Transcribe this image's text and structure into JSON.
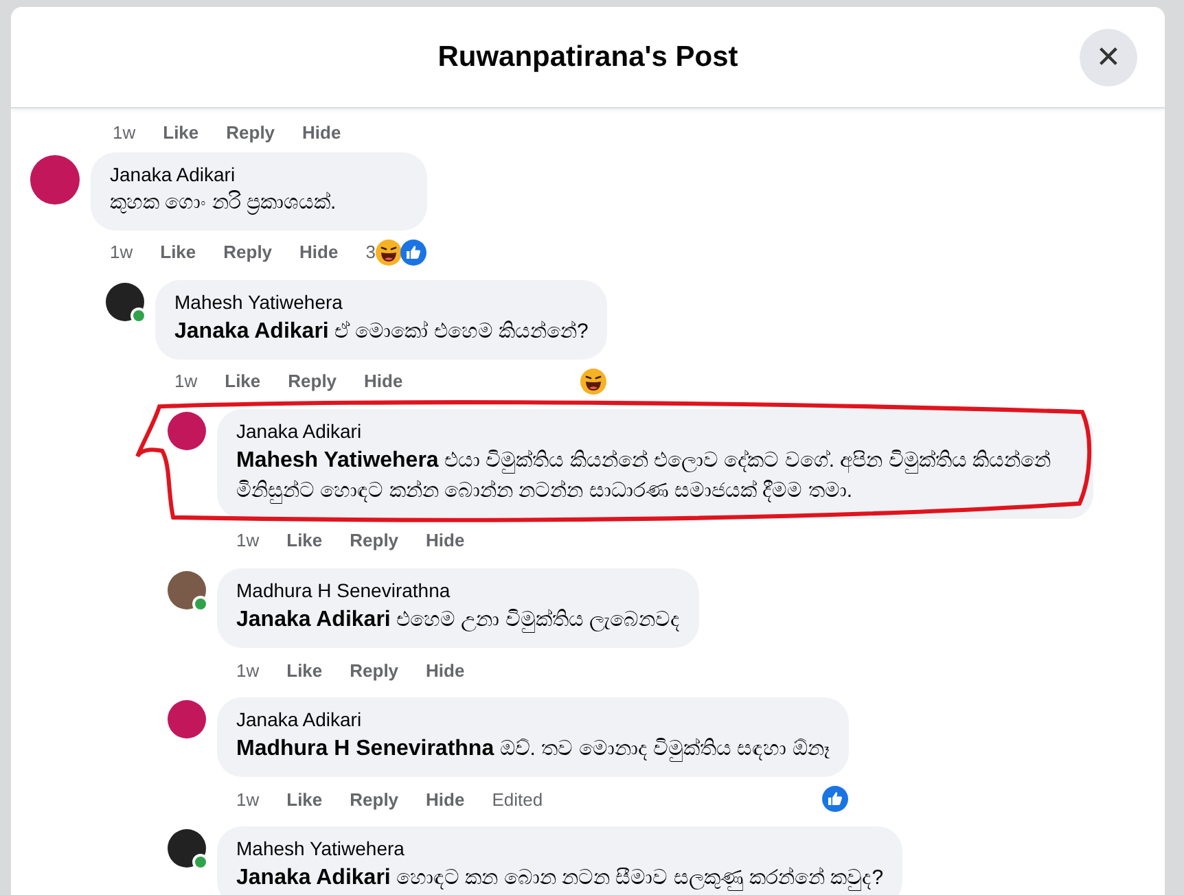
{
  "dialog": {
    "title": "Ruwanpatirana's Post",
    "close_icon": "✕"
  },
  "previous_actions": {
    "time": "1w",
    "actions": [
      "Like",
      "Reply",
      "Hide"
    ]
  },
  "comments": [
    {
      "author": "Janaka Adikari",
      "color": "#c2185b",
      "online": false,
      "highlighted": false,
      "text": "කුහක ගොං නරි ප්‍රකාශයක්.",
      "time": "1w",
      "actions": [
        "Like",
        "Reply",
        "Hide"
      ],
      "reactions": {
        "kind": "inline",
        "count": "3",
        "items": [
          {
            "kind": "haha"
          },
          {
            "kind": "like"
          }
        ]
      },
      "children": [
        {
          "author": "Mahesh Yatiwehera",
          "color": "#222222",
          "online": true,
          "highlighted": false,
          "mention": "Janaka Adikari",
          "text": "ඒ මොකෝ එහෙම කියන්නේ?",
          "time": "1w",
          "actions": [
            "Like",
            "Reply",
            "Hide"
          ],
          "reactions": {
            "kind": "end",
            "items": [
              {
                "kind": "haha"
              }
            ]
          },
          "children": [
            {
              "author": "Janaka Adikari",
              "color": "#c2185b",
              "online": false,
              "highlighted": true,
              "mention": "Mahesh Yatiwehera",
              "text": "එයා විමුක්තිය කියන්නේ එලොව දේකට වගේ. අපින විමුක්තිය කියන්නේ මිනිසුන්ට හොඳට කන්න බොන්න නටන්න සාධාරණ සමාජයක් දීමම තමා.",
              "time": "1w",
              "actions": [
                "Like",
                "Reply",
                "Hide"
              ]
            },
            {
              "author": "Madhura H Senevirathna",
              "color": "#7a5a48",
              "online": true,
              "highlighted": false,
              "mention": "Janaka Adikari",
              "text": "එහෙම උනා විමුක්තිය ලැබෙනවද",
              "time": "1w",
              "actions": [
                "Like",
                "Reply",
                "Hide"
              ]
            },
            {
              "author": "Janaka Adikari",
              "color": "#c2185b",
              "online": false,
              "highlighted": false,
              "mention": "Madhura H Senevirathna",
              "text": "ඔව්. තව මොනාද විමුක්තිය සඳහා ඕනෑ",
              "time": "1w",
              "actions": [
                "Like",
                "Reply",
                "Hide"
              ],
              "edited": "Edited",
              "reactions": {
                "kind": "end",
                "items": [
                  {
                    "kind": "like"
                  }
                ]
              }
            },
            {
              "author": "Mahesh Yatiwehera",
              "color": "#222222",
              "online": true,
              "highlighted": false,
              "mention": "Janaka Adikari",
              "text": "හොඳට කන බොන නටන සීමාව සලකුණු කරන්නේ කවුද?"
            }
          ]
        }
      ]
    }
  ]
}
